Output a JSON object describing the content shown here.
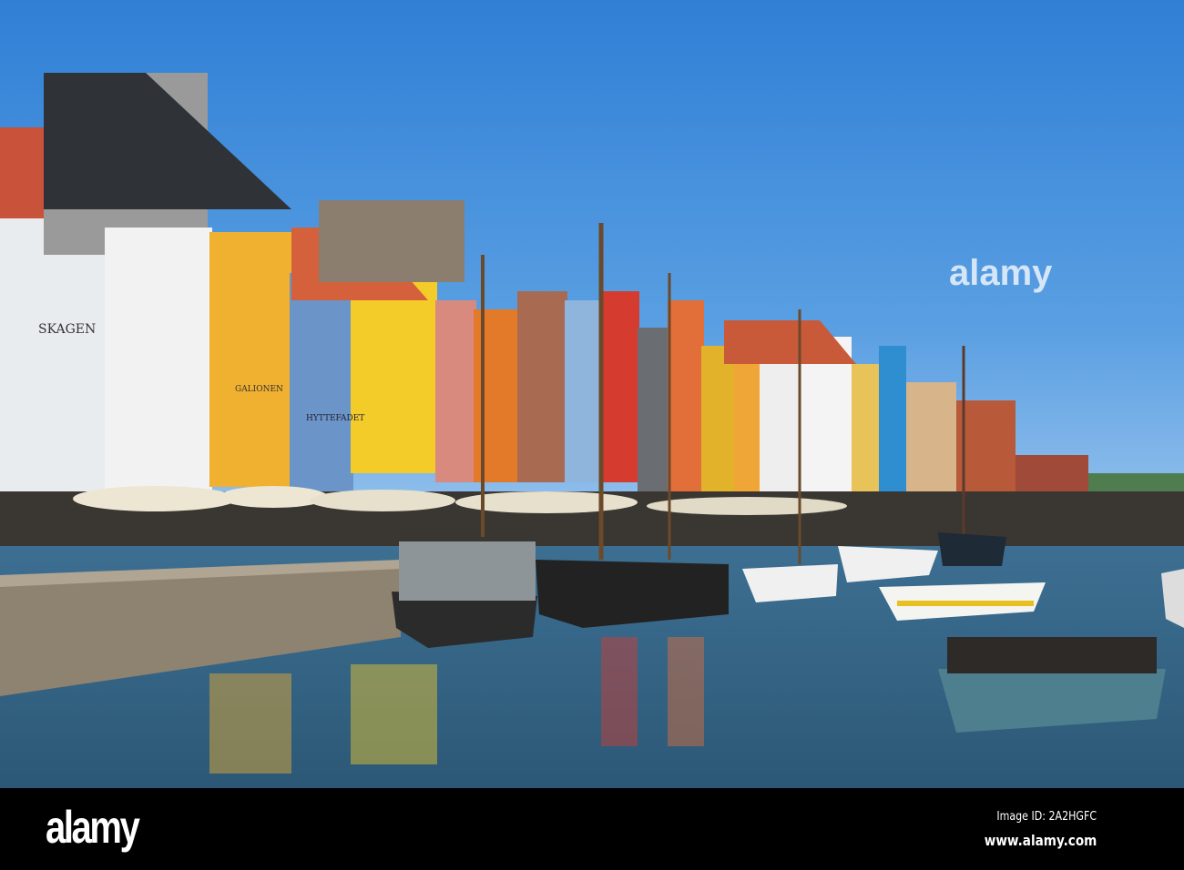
{
  "photo": {
    "subject": "Nyhavn canal harbour",
    "signs": [
      "SKAGEN",
      "HYTTEFADET",
      "GALIONEN"
    ],
    "watermark": "alamy"
  },
  "footer": {
    "logo": "alamy",
    "image_id": "Image ID: 2A2HGFC",
    "website": "www.alamy.com"
  }
}
